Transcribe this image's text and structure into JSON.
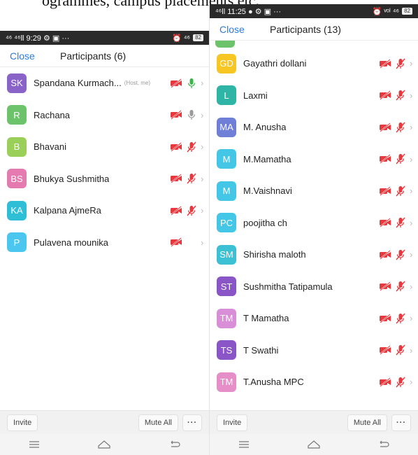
{
  "caption": "ogrammes, campus placements etc.",
  "left": {
    "status_time": "9:29",
    "status_left_extra": "⁴⁶ ⁴⁶ll",
    "status_right": "⏰ ⁴⁶",
    "battery": "82",
    "close_label": "Close",
    "title": "Participants (6)",
    "participants": [
      {
        "initials": "SK",
        "name": "Spandana Kurmach...",
        "tag": "(Host, me)",
        "color": "#8a63c9",
        "video": "off",
        "mic": "on"
      },
      {
        "initials": "R",
        "name": "Rachana",
        "tag": "",
        "color": "#6cc36c",
        "video": "off",
        "mic": "idle"
      },
      {
        "initials": "B",
        "name": "Bhavani",
        "tag": "",
        "color": "#9ad05a",
        "video": "off",
        "mic": "muted"
      },
      {
        "initials": "BS",
        "name": "Bhukya Sushmitha",
        "tag": "",
        "color": "#e57ab0",
        "video": "off",
        "mic": "muted"
      },
      {
        "initials": "KA",
        "name": "Kalpana AjmeRa",
        "tag": "",
        "color": "#2ebfd6",
        "video": "off",
        "mic": "muted"
      },
      {
        "initials": "P",
        "name": "Pulavena  mounika",
        "tag": "",
        "color": "#4ac6ef",
        "video": "off",
        "mic": "none"
      }
    ],
    "invite_label": "Invite",
    "mute_all_label": "Mute All",
    "more_label": "···"
  },
  "right": {
    "status_time": "11:25",
    "status_right": "⏰ ᵛᵒˡ ⁴⁶",
    "battery": "82",
    "close_label": "Close",
    "title": "Participants (13)",
    "participants": [
      {
        "initials": "GD",
        "name": "Gayathri dollani",
        "color": "#f7c623"
      },
      {
        "initials": "L",
        "name": "Laxmi",
        "color": "#2fb5a5"
      },
      {
        "initials": "MA",
        "name": "M. Anusha",
        "color": "#6f7fd8"
      },
      {
        "initials": "M",
        "name": "M.Mamatha",
        "color": "#44c6e6"
      },
      {
        "initials": "M",
        "name": "M.Vaishnavi",
        "color": "#44c6e6"
      },
      {
        "initials": "PC",
        "name": "poojitha ch",
        "color": "#44c6e6"
      },
      {
        "initials": "SM",
        "name": "Shirisha maloth",
        "color": "#3cc0d4"
      },
      {
        "initials": "ST",
        "name": "Sushmitha Tatipamula",
        "color": "#8a55c6"
      },
      {
        "initials": "TM",
        "name": "T Mamatha",
        "color": "#d98ed8"
      },
      {
        "initials": "TS",
        "name": "T Swathi",
        "color": "#8a55c6"
      },
      {
        "initials": "TM",
        "name": "T.Anusha MPC",
        "color": "#e58ec8"
      }
    ],
    "peek_color": "#6cc36c",
    "invite_label": "Invite",
    "mute_all_label": "Mute All",
    "more_label": "···"
  }
}
